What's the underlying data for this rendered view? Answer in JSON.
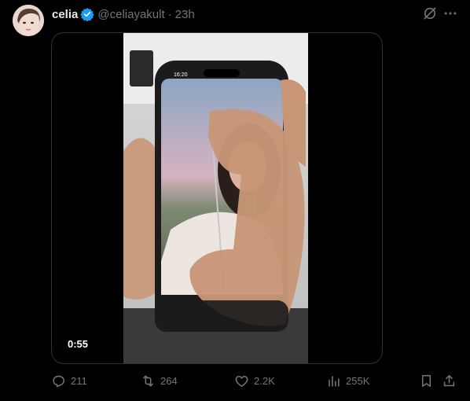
{
  "tweet": {
    "author_name": "celia",
    "handle": "@celiayakult",
    "separator": "·",
    "time": "23h",
    "verified": true
  },
  "media": {
    "type": "video",
    "duration": "0:55",
    "phone_status_time": "16:20"
  },
  "actions": {
    "replies": "211",
    "retweets": "264",
    "likes": "2.2K",
    "views": "255K"
  },
  "icons": {
    "verified": "verified-badge-icon",
    "grok": "grok-icon",
    "more": "more-icon",
    "reply": "reply-icon",
    "retweet": "retweet-icon",
    "like": "heart-icon",
    "views": "views-chart-icon",
    "bookmark": "bookmark-icon",
    "share": "share-icon"
  },
  "colors": {
    "background": "#000000",
    "text_primary": "#e7e9ea",
    "text_secondary": "#71767b",
    "verified_blue": "#1d9bf0",
    "border": "#2f3336"
  }
}
